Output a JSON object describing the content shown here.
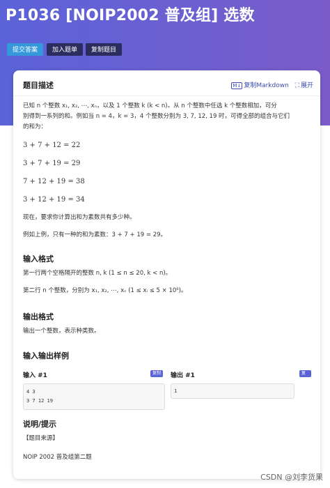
{
  "page": {
    "title": "P1036 [NOIP2002 普及组] 选数",
    "buttons": {
      "submit": "提交答案",
      "add_to_list": "加入题单",
      "copy_problem": "复制题目"
    }
  },
  "card": {
    "title": "题目描述",
    "copy_markdown": "复制Markdown",
    "expand": "展开",
    "md_badge": "M↓",
    "expand_glyph": "⛶"
  },
  "description": {
    "para1_line1": "已知 n 个整数 x₁, x₂, ⋯, xₙ，以及 1 个整数 k (k < n)。从 n 个整数中任选 k 个整数相加，可分",
    "para1_line2": "别得到一系列的和。例如当 n = 4，k = 3，4 个整数分别为 3, 7, 12, 19 时，可得全部的组合与它们",
    "para1_line3": "的和为：",
    "equations": [
      "3 + 7 + 12 = 22",
      "3 + 7 + 19 = 29",
      "7 + 12 + 19 = 38",
      "3 + 12 + 19 = 34"
    ],
    "para2": "现在，要求你计算出和为素数共有多少种。",
    "para3": "例如上例，只有一种的和为素数：3 + 7 + 19 = 29。"
  },
  "input_format": {
    "heading": "输入格式",
    "line1": "第一行两个空格隔开的整数 n, k (1 ≤ n ≤ 20, k < n)。",
    "line2": "第二行 n 个整数，分别为 x₁, x₂, ⋯, xₙ (1 ≤ xᵢ ≤ 5 × 10⁶)。"
  },
  "output_format": {
    "heading": "输出格式",
    "line1": "输出一个整数，表示种类数。"
  },
  "samples": {
    "heading": "输入输出样例",
    "input_label": "输入 #1",
    "output_label": "输出 #1",
    "copy_label": "复制",
    "input_lines": [
      "4 3",
      "3 7 12 19"
    ],
    "output_lines": [
      "1"
    ]
  },
  "notes": {
    "heading": "说明/提示",
    "source_label": "【题目来源】",
    "source_text": "NOIP 2002 普及组第二题"
  },
  "watermark": "CSDN @刘李货果"
}
